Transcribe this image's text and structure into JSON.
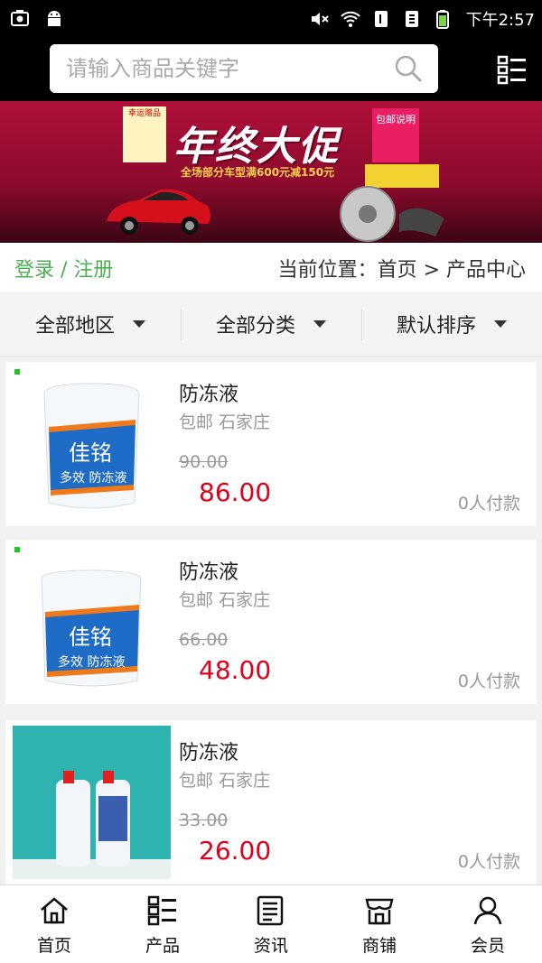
{
  "status": {
    "time": "下午2:57",
    "icons": [
      "screenshot-icon",
      "android-icon",
      "mute-icon",
      "wifi-icon",
      "sim1-icon",
      "sim2-icon",
      "battery-icon"
    ]
  },
  "search": {
    "placeholder": "请输入商品关键字"
  },
  "banner": {
    "title": "年终大促",
    "subtitle": "全场部分车型满600元减150元",
    "note": "包邮说明",
    "tag": "幸运赠品"
  },
  "crumbs": {
    "login": "登录 / 注册",
    "location": "当前位置：首页 > 产品中心"
  },
  "filters": [
    {
      "label": "全部地区"
    },
    {
      "label": "全部分类"
    },
    {
      "label": "默认排序"
    }
  ],
  "products": [
    {
      "name": "防冻液",
      "location": "包邮 石家庄",
      "old_price": "90.00",
      "price": "86.00",
      "paid": "0人付款"
    },
    {
      "name": "防冻液",
      "location": "包邮 石家庄",
      "old_price": "66.00",
      "price": "48.00",
      "paid": "0人付款"
    },
    {
      "name": "防冻液",
      "location": "包邮 石家庄",
      "old_price": "33.00",
      "price": "26.00",
      "paid": "0人付款"
    }
  ],
  "tabs": [
    {
      "label": "首页",
      "icon": "home-icon"
    },
    {
      "label": "产品",
      "icon": "product-grid-icon"
    },
    {
      "label": "资讯",
      "icon": "news-icon"
    },
    {
      "label": "商铺",
      "icon": "store-icon"
    },
    {
      "label": "会员",
      "icon": "user-icon"
    }
  ],
  "colors": {
    "accent_green": "#4caf50",
    "price_red": "#e1001a",
    "banner_red": "#b0103a"
  }
}
